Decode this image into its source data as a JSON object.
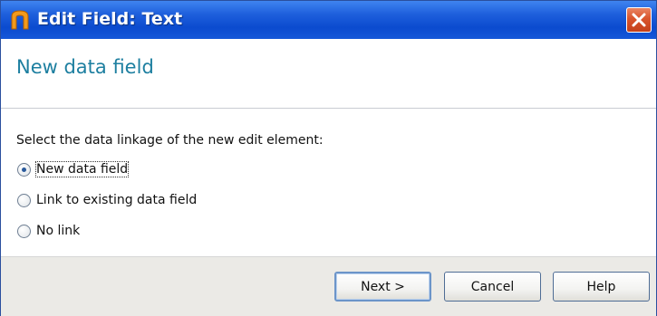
{
  "window": {
    "title": "Edit Field: Text",
    "title_bar_color": "#1e5fdc",
    "close_button_color": "#d9542c"
  },
  "header": {
    "title": "New data field",
    "title_color": "#1d7fa0"
  },
  "content": {
    "prompt": "Select the data linkage of the new edit element:",
    "options": [
      {
        "label": "New data field",
        "selected": true
      },
      {
        "label": "Link to existing data field",
        "selected": false
      },
      {
        "label": "No link",
        "selected": false
      }
    ]
  },
  "footer": {
    "next_label": "Next >",
    "cancel_label": "Cancel",
    "help_label": "Help"
  },
  "icons": {
    "app": "app-logo-icon",
    "close": "close-icon"
  }
}
